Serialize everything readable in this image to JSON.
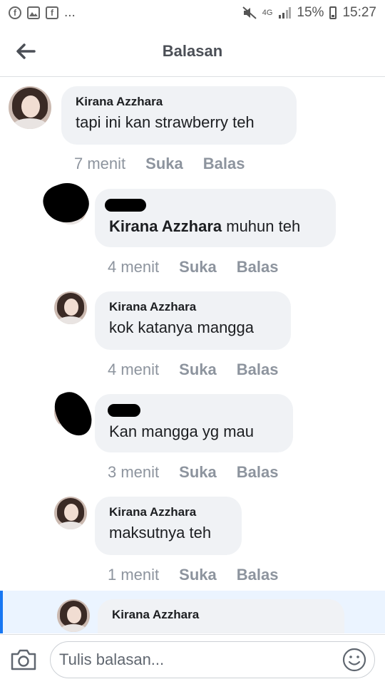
{
  "status_bar": {
    "dots": "...",
    "network": "4G",
    "battery": "15%",
    "time": "15:27"
  },
  "header": {
    "title": "Balasan"
  },
  "comments": [
    {
      "author": "Kirana Azzhara",
      "text": "tapi ini kan strawberry teh",
      "time": "7 menit",
      "like": "Suka",
      "reply": "Balas"
    },
    {
      "author": "",
      "mention": "Kirana Azzhara",
      "text": " muhun teh",
      "time": "4 menit",
      "like": "Suka",
      "reply": "Balas"
    },
    {
      "author": "Kirana Azzhara",
      "text": "kok katanya mangga",
      "time": "4 menit",
      "like": "Suka",
      "reply": "Balas"
    },
    {
      "author": "",
      "text": "Kan mangga yg mau",
      "time": "3 menit",
      "like": "Suka",
      "reply": "Balas"
    },
    {
      "author": "Kirana Azzhara",
      "text": "maksutnya teh",
      "time": "1 menit",
      "like": "Suka",
      "reply": "Balas"
    },
    {
      "author": "Kirana Azzhara",
      "text": ""
    }
  ],
  "composer": {
    "placeholder": "Tulis balasan..."
  },
  "icons": {
    "back": "arrow-left-icon",
    "camera": "camera-icon",
    "emoji": "smiley-icon",
    "mute": "mute-icon",
    "signal": "signal-icon"
  }
}
